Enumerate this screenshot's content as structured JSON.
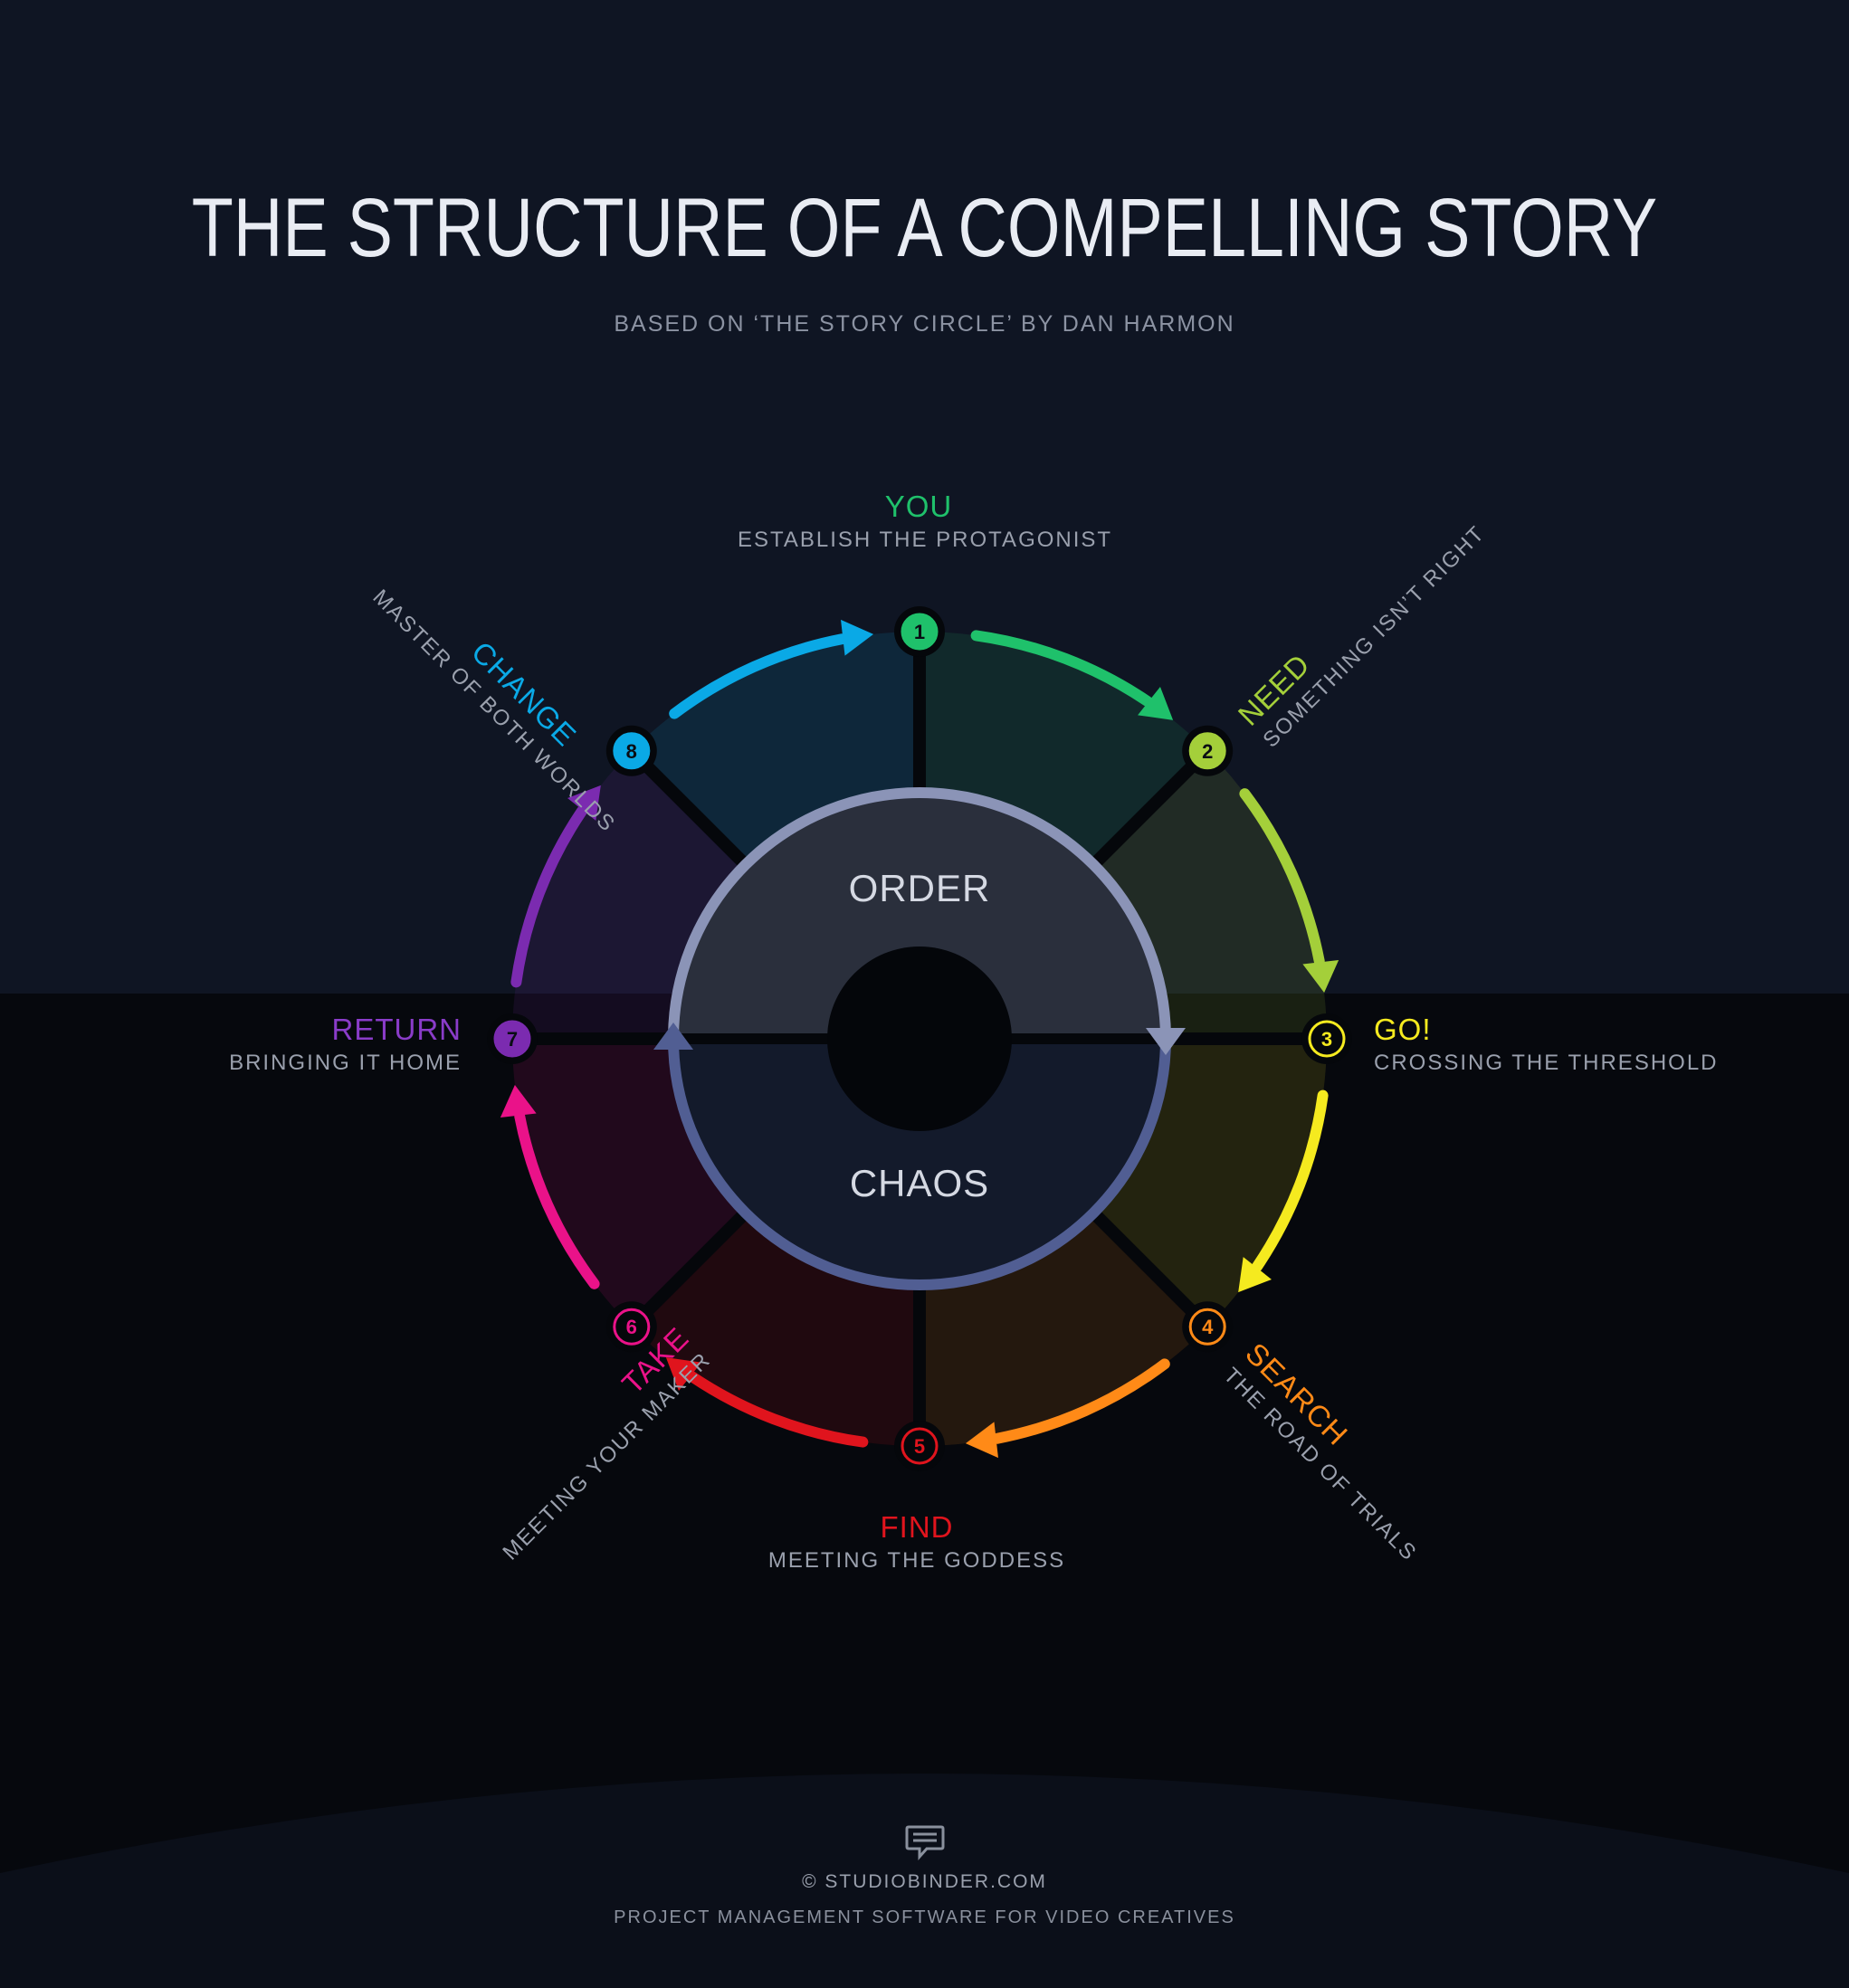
{
  "header": {
    "title": "THE STRUCTURE OF A COMPELLING STORY",
    "subtitle": "BASED ON ‘THE STORY CIRCLE’ BY DAN HARMON"
  },
  "center": {
    "upper_label": "ORDER",
    "lower_label": "CHAOS"
  },
  "stages": [
    {
      "number": "1",
      "name": "YOU",
      "description": "ESTABLISH THE PROTAGONIST",
      "color": "#1fc16b"
    },
    {
      "number": "2",
      "name": "NEED",
      "description": "SOMETHING ISN’T RIGHT",
      "color": "#a4cf3a"
    },
    {
      "number": "3",
      "name": "GO!",
      "description": "CROSSING THE THRESHOLD",
      "color": "#f5ea1f"
    },
    {
      "number": "4",
      "name": "SEARCH",
      "description": "THE ROAD OF TRIALS",
      "color": "#ff8a17"
    },
    {
      "number": "5",
      "name": "FIND",
      "description": "MEETING THE GODDESS",
      "color": "#e0141d"
    },
    {
      "number": "6",
      "name": "TAKE",
      "description": "MEETING YOUR MAKER",
      "color": "#ea1289"
    },
    {
      "number": "7",
      "name": "RETURN",
      "description": "BRINGING IT HOME",
      "color": "#7b2bb0"
    },
    {
      "number": "8",
      "name": "CHANGE",
      "description": "MASTER OF BOTH WORLDS",
      "color": "#0aa9e6"
    }
  ],
  "footer": {
    "copyright": "© STUDIOBINDER.COM",
    "tagline": "PROJECT MANAGEMENT SOFTWARE FOR VIDEO CREATIVES",
    "logo_icon": "speech-bubble-icon"
  }
}
